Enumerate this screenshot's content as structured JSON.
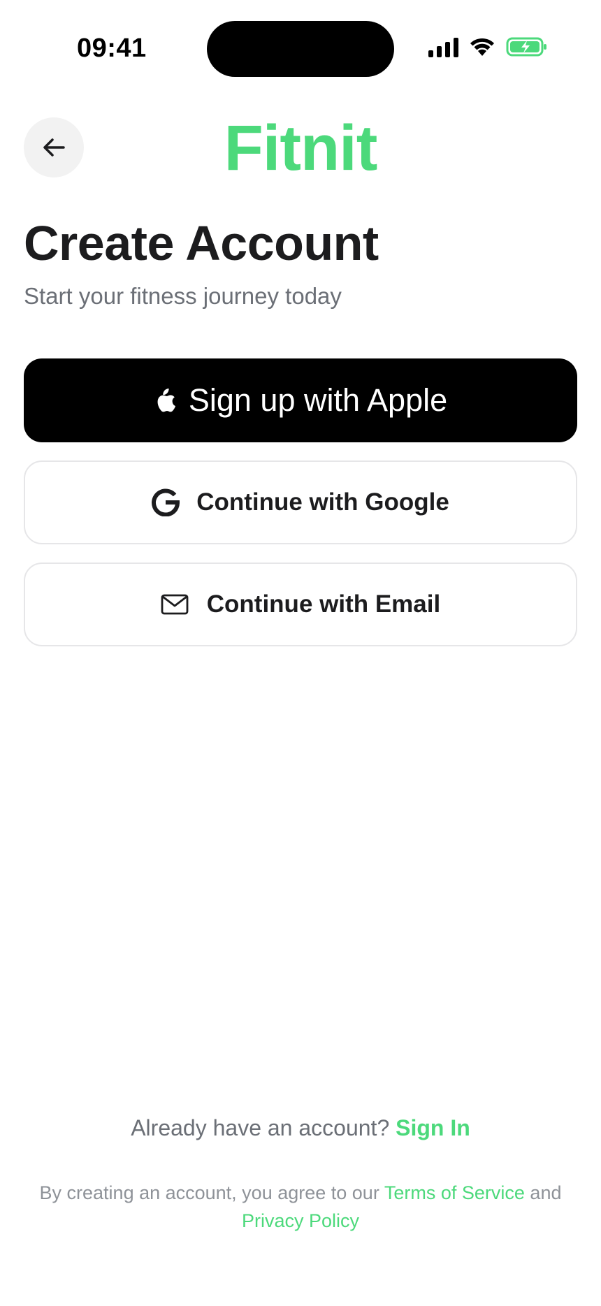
{
  "status_bar": {
    "time": "09:41",
    "icons": [
      "signal-icon",
      "wifi-icon",
      "battery-charging-icon"
    ]
  },
  "header": {
    "back_icon": "arrow-left-icon",
    "brand": "Fitnit"
  },
  "main": {
    "title": "Create Account",
    "subtitle": "Start your fitness journey today",
    "buttons": {
      "apple": {
        "label": "Sign up with Apple",
        "icon": "apple-icon"
      },
      "google": {
        "label": "Continue with Google",
        "icon": "google-icon"
      },
      "email": {
        "label": "Continue with Email",
        "icon": "mail-icon"
      }
    }
  },
  "footer": {
    "signin_prompt": "Already have an account?",
    "signin_link": "Sign In",
    "legal_prefix": "By creating an account, you agree to our",
    "terms_link": "Terms of Service",
    "legal_and": "and",
    "privacy_link": "Privacy Policy"
  },
  "colors": {
    "accent": "#4cd97b",
    "text_primary": "#1c1c1e",
    "text_secondary": "#6b6f76",
    "button_dark": "#000000",
    "border": "#e6e6e8"
  }
}
